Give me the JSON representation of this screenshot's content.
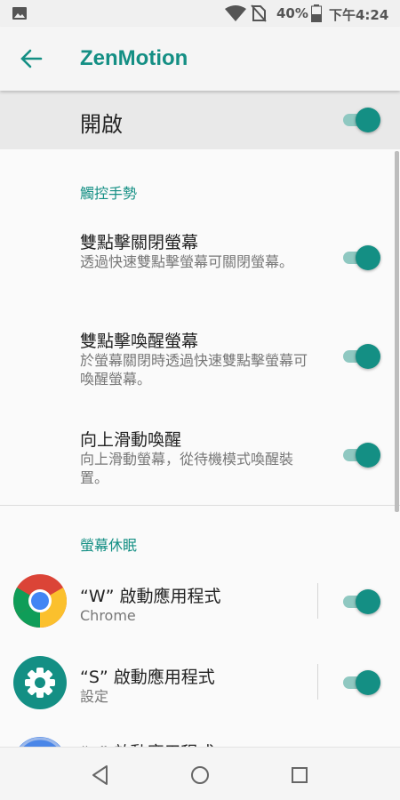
{
  "status_bar": {
    "battery_percent": "40%",
    "time": "下午4:24"
  },
  "app_bar": {
    "title": "ZenMotion"
  },
  "master_switch": {
    "label": "開啟",
    "on": true
  },
  "sections": [
    {
      "header": "觸控手勢",
      "items": [
        {
          "title": "雙點擊關閉螢幕",
          "subtitle": "透過快速雙點擊螢幕可關閉螢幕。",
          "on": true
        },
        {
          "title": "雙點擊喚醒螢幕",
          "subtitle": "於螢幕關閉時透過快速雙點擊螢幕可喚醒螢幕。",
          "on": true
        },
        {
          "title": "向上滑動喚醒",
          "subtitle": "向上滑動螢幕，從待機模式喚醒裝置。",
          "on": true
        }
      ]
    },
    {
      "header": "螢幕休眠",
      "items": [
        {
          "title": "“W” 啟動應用程式",
          "subtitle": "Chrome",
          "icon": "chrome-icon",
          "on": true
        },
        {
          "title": "“S” 啟動應用程式",
          "subtitle": "設定",
          "icon": "settings-gear-icon",
          "on": true
        },
        {
          "title": "“e” 啟動應用程式",
          "subtitle": "",
          "icon": "browser-icon",
          "on": true
        }
      ]
    }
  ],
  "colors": {
    "accent": "#148f84",
    "accent_light": "#8fc8c1"
  }
}
